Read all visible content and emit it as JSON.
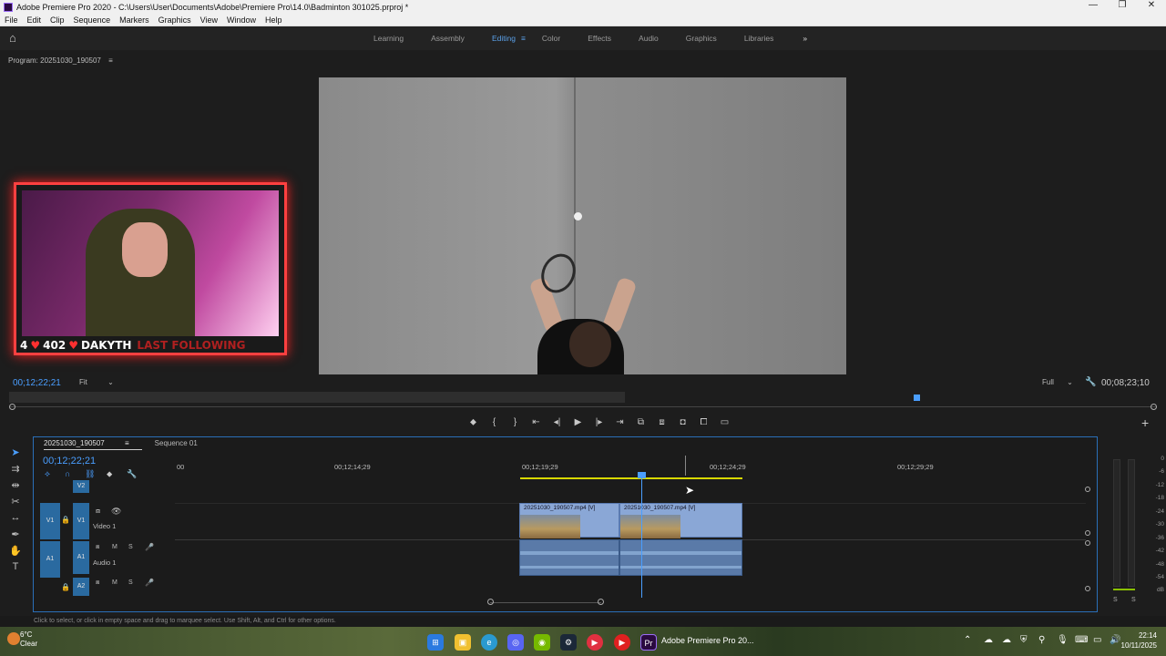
{
  "window": {
    "title": "Adobe Premiere Pro 2020 - C:\\Users\\User\\Documents\\Adobe\\Premiere Pro\\14.0\\Badminton 301025.prproj *",
    "controls": [
      "—",
      "❐",
      "✕"
    ]
  },
  "menu": [
    "File",
    "Edit",
    "Clip",
    "Sequence",
    "Markers",
    "Graphics",
    "View",
    "Window",
    "Help"
  ],
  "workspaces": {
    "tabs": [
      "Learning",
      "Assembly",
      "Editing",
      "Color",
      "Effects",
      "Audio",
      "Graphics",
      "Libraries"
    ],
    "active": "Editing",
    "more": "»"
  },
  "program_monitor": {
    "label": "Program: 20251030_190507",
    "menu_icon": "≡",
    "timecode_current": "00;12;22;21",
    "fit": "Fit",
    "quality": "Full",
    "timecode_duration": "00;08;23;10"
  },
  "webcam_overlay": {
    "followers_count": "4",
    "subs_count": "402",
    "name": "DAKYTH",
    "tag": "LAST FOLLOWING"
  },
  "timeline": {
    "tabs": [
      "20251030_190507",
      "Sequence 01"
    ],
    "active_tab": "20251030_190507",
    "timecode": "00;12;22;21",
    "ruler": [
      "00",
      "00;12;14;29",
      "00;12;19;29",
      "00;12;24;29",
      "00;12;29;29"
    ],
    "tracks": {
      "v2": "V2",
      "v1_src": "V1",
      "v1": "V1",
      "v1_name": "Video 1",
      "a1_src": "A1",
      "a1": "A1",
      "a1_name": "Audio 1",
      "a2": "A2"
    },
    "clips": [
      {
        "name": "20251030_190507.mp4 [V]"
      },
      {
        "name": "20251030_190507.mp4 [V]"
      }
    ]
  },
  "meters": {
    "scale": [
      "0",
      "-6",
      "-12",
      "-18",
      "-24",
      "-30",
      "-36",
      "-42",
      "-48",
      "-54",
      "dB"
    ],
    "solo": [
      "S",
      "S"
    ]
  },
  "status": "Click to select, or click in empty space and drag to marquee select. Use Shift, Alt, and Ctrl for other options.",
  "taskbar": {
    "weather_temp": "6°C",
    "weather_desc": "Clear",
    "active_app": "Adobe Premiere Pro 20...",
    "time": "22:14",
    "date": "10/11/2025"
  }
}
